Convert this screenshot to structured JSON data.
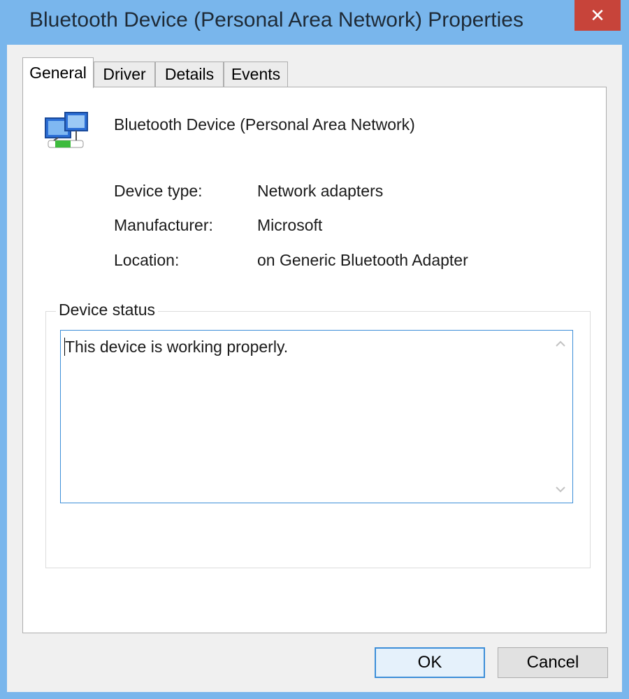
{
  "window": {
    "title": "Bluetooth Device (Personal Area Network) Properties",
    "close_glyph": "✕"
  },
  "tabs": [
    {
      "label": "General",
      "active": true
    },
    {
      "label": "Driver",
      "active": false
    },
    {
      "label": "Details",
      "active": false
    },
    {
      "label": "Events",
      "active": false
    }
  ],
  "general": {
    "device_name": "Bluetooth Device (Personal Area Network)",
    "device_icon": "network-adapter-icon",
    "properties": [
      {
        "label": "Device type:",
        "value": "Network adapters"
      },
      {
        "label": "Manufacturer:",
        "value": "Microsoft"
      },
      {
        "label": "Location:",
        "value": "on Generic Bluetooth Adapter"
      }
    ],
    "status_group_label": "Device status",
    "status_text": "This device is working properly."
  },
  "buttons": {
    "ok": "OK",
    "cancel": "Cancel"
  },
  "colors": {
    "frame": "#79b6ec",
    "close": "#c7443a",
    "focus": "#3c8ed8"
  }
}
